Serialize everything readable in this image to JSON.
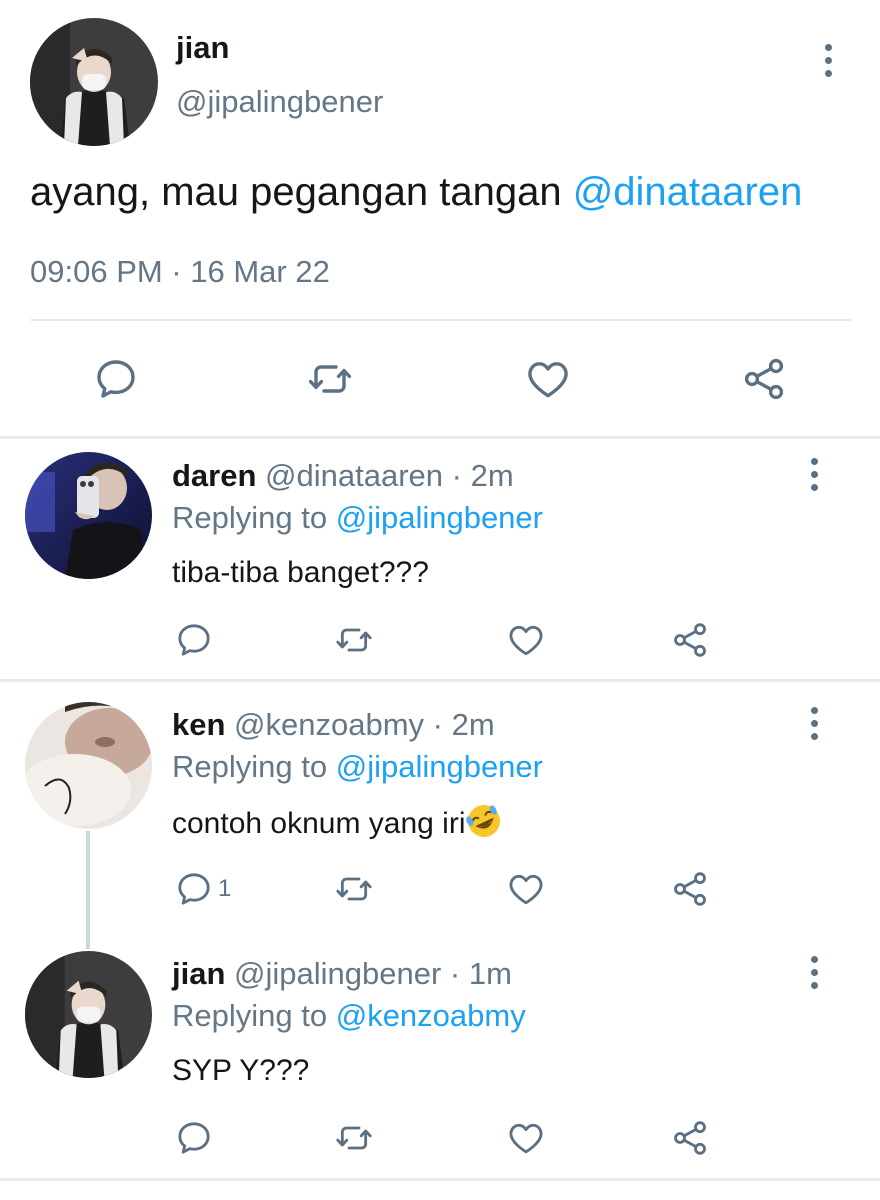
{
  "main_tweet": {
    "name": "jian",
    "handle": "@jipalingbener",
    "text": "ayang, mau pegangan tangan ",
    "mention": "@dinataaren",
    "timestamp": "09:06 PM · 16 Mar 22",
    "actions": [
      "reply-icon",
      "retweet-icon",
      "like-icon",
      "share-icon"
    ]
  },
  "replies": [
    {
      "name": "daren",
      "handle": "@dinataaren · 2m",
      "replying_prefix": "Replying to ",
      "replying_to": "@jipalingbener",
      "text": "tiba-tiba banget???",
      "reply_count": ""
    },
    {
      "name": "ken",
      "handle": "@kenzoabmy · 2m",
      "replying_prefix": "Replying to ",
      "replying_to": "@jipalingbener",
      "text": "contoh oknum yang iri",
      "emoji": "rolling-on-floor-laughing-emoji",
      "reply_count": "1"
    },
    {
      "name": "jian",
      "handle": "@jipalingbener · 1m",
      "replying_prefix": "Replying to ",
      "replying_to": "@kenzoabmy",
      "text": "SYP Y???",
      "reply_count": ""
    }
  ],
  "colors": {
    "accent": "#1da1f2",
    "text_primary": "#14171a",
    "text_secondary": "#657786",
    "icon": "#5b7083",
    "divider": "#e6ecf0"
  }
}
